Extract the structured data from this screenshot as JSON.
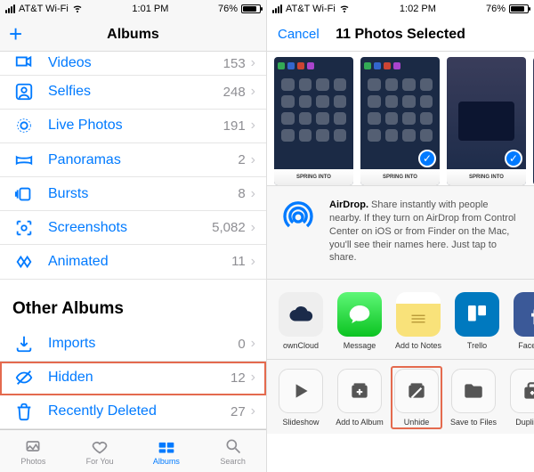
{
  "left": {
    "status": {
      "carrier": "AT&T Wi-Fi",
      "time": "1:01 PM",
      "battery_pct": "76%"
    },
    "nav": {
      "title": "Albums"
    },
    "albums": [
      {
        "key": "videos",
        "label": "Videos",
        "count": "153"
      },
      {
        "key": "selfies",
        "label": "Selfies",
        "count": "248"
      },
      {
        "key": "livephotos",
        "label": "Live Photos",
        "count": "191"
      },
      {
        "key": "panoramas",
        "label": "Panoramas",
        "count": "2"
      },
      {
        "key": "bursts",
        "label": "Bursts",
        "count": "8"
      },
      {
        "key": "screenshots",
        "label": "Screenshots",
        "count": "5,082"
      },
      {
        "key": "animated",
        "label": "Animated",
        "count": "11"
      }
    ],
    "other_header": "Other Albums",
    "other": [
      {
        "key": "imports",
        "label": "Imports",
        "count": "0"
      },
      {
        "key": "hidden",
        "label": "Hidden",
        "count": "12"
      },
      {
        "key": "deleted",
        "label": "Recently Deleted",
        "count": "27"
      }
    ],
    "tabs": {
      "photos": "Photos",
      "foryou": "For You",
      "albums": "Albums",
      "search": "Search"
    }
  },
  "right": {
    "status": {
      "carrier": "AT&T Wi-Fi",
      "time": "1:02 PM",
      "battery_pct": "76%"
    },
    "nav": {
      "cancel": "Cancel",
      "title": "11 Photos Selected"
    },
    "thumb_strip": "SPRING INTO",
    "airdrop": {
      "bold": "AirDrop.",
      "text": " Share instantly with people nearby. If they turn on AirDrop from Control Center on iOS or from Finder on the Mac, you'll see their names here. Just tap to share."
    },
    "apps": [
      {
        "key": "owncloud",
        "label": "ownCloud"
      },
      {
        "key": "message",
        "label": "Message"
      },
      {
        "key": "notes",
        "label": "Add to Notes"
      },
      {
        "key": "trello",
        "label": "Trello"
      },
      {
        "key": "facebook",
        "label": "Facebook"
      }
    ],
    "actions": [
      {
        "key": "slideshow",
        "label": "Slideshow"
      },
      {
        "key": "addtoalbum",
        "label": "Add to Album"
      },
      {
        "key": "unhide",
        "label": "Unhide"
      },
      {
        "key": "savefiles",
        "label": "Save to Files"
      },
      {
        "key": "duplicate",
        "label": "Duplicate"
      }
    ]
  }
}
